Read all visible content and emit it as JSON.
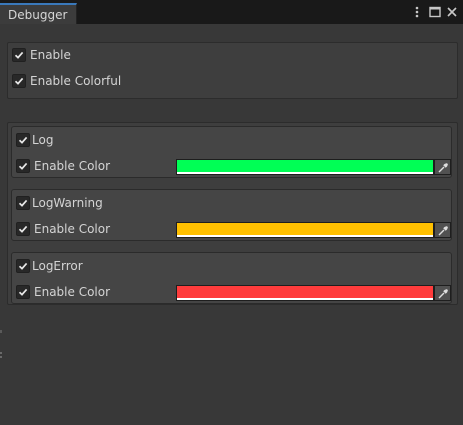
{
  "window": {
    "tab_title": "Debugger"
  },
  "toolbar_icons": [
    "more-vert-icon",
    "maximize-icon",
    "close-icon"
  ],
  "general": {
    "enable_label": "Enable",
    "enable_checked": true,
    "colorful_label": "Enable Colorful",
    "colorful_checked": true
  },
  "groups": [
    {
      "title": "Log",
      "checked": true,
      "color_label": "Enable Color",
      "color_checked": true,
      "color": "#00ff55"
    },
    {
      "title": "LogWarning",
      "checked": true,
      "color_label": "Enable Color",
      "color_checked": true,
      "color": "#ffc000"
    },
    {
      "title": "LogError",
      "checked": true,
      "color_label": "Enable Color",
      "color_checked": true,
      "color": "#ff3c3c"
    }
  ]
}
